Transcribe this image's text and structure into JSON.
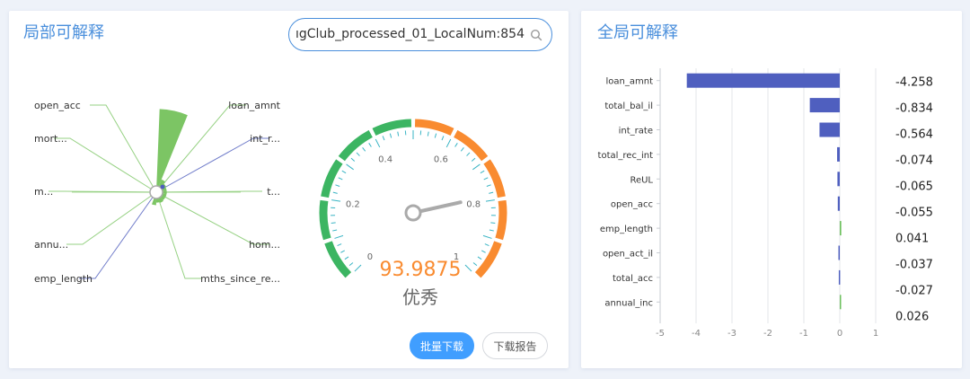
{
  "local_panel": {
    "title": "局部可解释",
    "search": {
      "value": "ıgClub_processed_01_LocalNum:854"
    },
    "radial_labels": [
      "loan_amnt",
      "int_r...",
      "t...",
      "hom...",
      "mths_since_re...",
      "emp_length",
      "annu...",
      "m...",
      "mort...",
      "open_acc"
    ],
    "radial_values": [
      0.92,
      0.08,
      0.05,
      0.04,
      0.04,
      0.04,
      0.04,
      0.05,
      0.04,
      0.07
    ],
    "gauge": {
      "value": "93.9875",
      "grade": "优秀",
      "ticks": [
        "0",
        "0.2",
        "0.4",
        "0.6",
        "0.8",
        "1"
      ],
      "needle_fraction": 0.12
    },
    "buttons": {
      "batch_download": "批量下载",
      "download_report": "下载报告"
    },
    "colors": {
      "green": "#3cb562",
      "orange": "#f98b30",
      "light_green": "#7cc564",
      "navy": "#4d5dbd"
    }
  },
  "global_panel": {
    "title": "全局可解释",
    "chart_data": {
      "type": "bar",
      "orientation": "horizontal",
      "categories": [
        "loan_amnt",
        "total_bal_il",
        "int_rate",
        "total_rec_int",
        "ReUL",
        "open_acc",
        "emp_length",
        "open_act_il",
        "total_acc",
        "annual_inc"
      ],
      "values": [
        -4.258,
        -0.834,
        -0.564,
        -0.074,
        -0.065,
        -0.055,
        0.041,
        -0.037,
        -0.027,
        0.026
      ],
      "value_labels": [
        "-4.258",
        "-0.834",
        "-0.564",
        "-0.074",
        "-0.065",
        "-0.055",
        "0.041",
        "-0.037",
        "-0.027",
        "0.026"
      ],
      "xlim": [
        -5,
        1
      ],
      "xticks": [
        "-5",
        "-4",
        "-3",
        "-2",
        "-1",
        "0",
        "1"
      ],
      "grid": true,
      "colors": {
        "negative": "#4f5fbf",
        "positive": "#6cc05c"
      }
    }
  }
}
